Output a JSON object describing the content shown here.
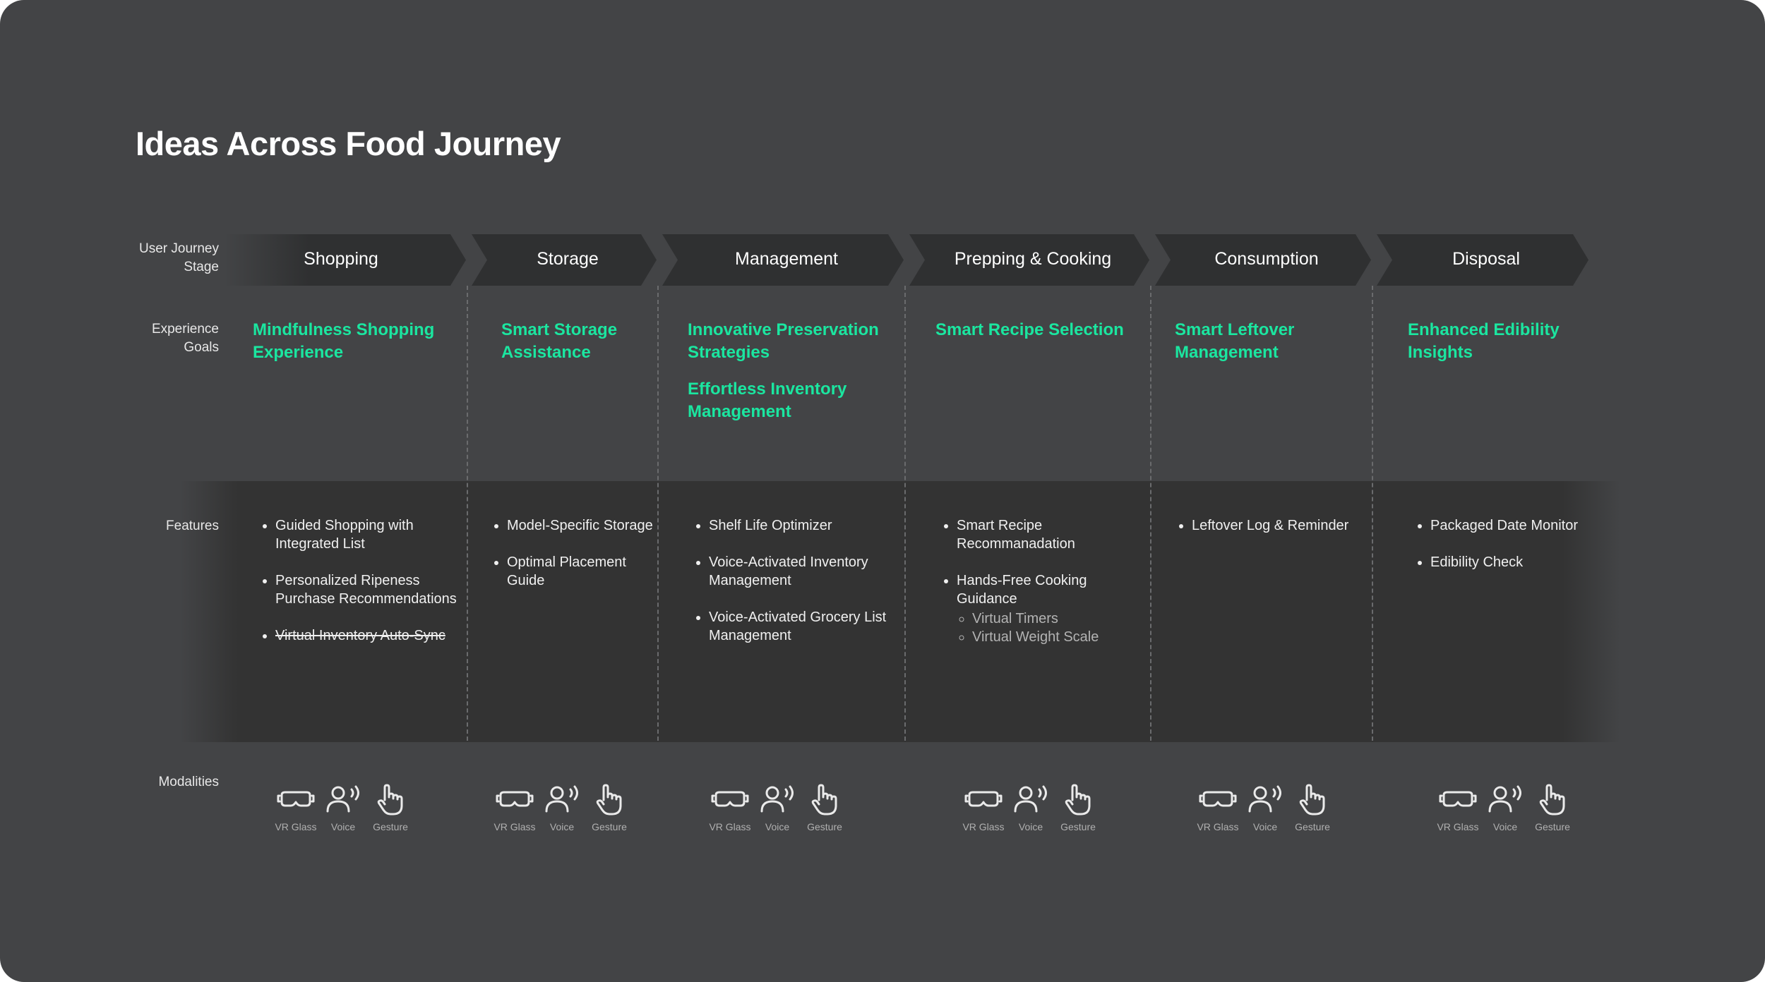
{
  "title": "Ideas Across Food Journey",
  "row_labels": {
    "stage_line1": "User Journey",
    "stage_line2": "Stage",
    "goals_line1": "Experience",
    "goals_line2": "Goals",
    "features": "Features",
    "modalities": "Modalities"
  },
  "stages": [
    {
      "name": "Shopping",
      "goals": [
        "Mindfulness Shopping Experience"
      ],
      "features": [
        {
          "text": "Guided Shopping with Integrated List"
        },
        {
          "text": "Personalized Ripeness Purchase Recommendations"
        },
        {
          "text": "Virtual Inventory Auto-Sync",
          "struck": true
        }
      ]
    },
    {
      "name": "Storage",
      "goals": [
        "Smart Storage Assistance"
      ],
      "features": [
        {
          "text": "Model-Specific Storage"
        },
        {
          "text": "Optimal Placement Guide"
        }
      ]
    },
    {
      "name": "Management",
      "goals": [
        "Innovative Preservation Strategies",
        "Effortless Inventory Management"
      ],
      "features": [
        {
          "text": "Shelf Life Optimizer"
        },
        {
          "text": "Voice-Activated Inventory Management"
        },
        {
          "text": "Voice-Activated Grocery List Management"
        }
      ]
    },
    {
      "name": "Prepping & Cooking",
      "goals": [
        "Smart Recipe Selection"
      ],
      "features": [
        {
          "text": "Smart Recipe Recommanadation"
        },
        {
          "text": "Hands-Free Cooking Guidance",
          "sub": [
            "Virtual Timers",
            "Virtual Weight Scale"
          ]
        }
      ]
    },
    {
      "name": "Consumption",
      "goals": [
        "Smart Leftover Management"
      ],
      "features": [
        {
          "text": "Leftover Log & Reminder"
        }
      ]
    },
    {
      "name": "Disposal",
      "goals": [
        "Enhanced Edibility Insights"
      ],
      "features": [
        {
          "text": "Packaged Date Monitor"
        },
        {
          "text": "Edibility Check"
        }
      ]
    }
  ],
  "modalities": [
    {
      "label": "VR Glass",
      "icon": "vr-glass-icon"
    },
    {
      "label": "Voice",
      "icon": "voice-icon"
    },
    {
      "label": "Gesture",
      "icon": "gesture-icon"
    }
  ],
  "colors": {
    "background": "#434446",
    "goal_accent": "#1be6a0",
    "stage_bar": "#2f3031",
    "features_band": "#333333"
  }
}
